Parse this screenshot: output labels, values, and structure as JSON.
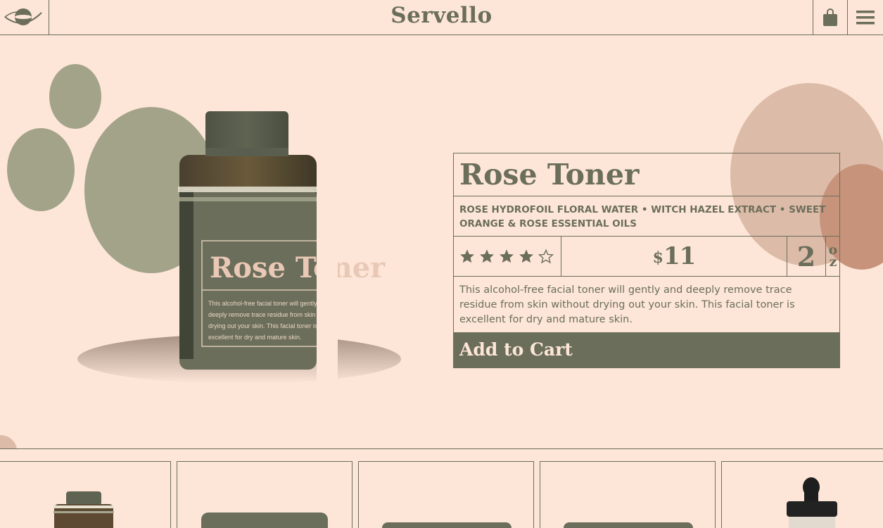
{
  "header": {
    "brand": "Servello",
    "logo_icon": "planet-logo-icon",
    "bag_icon": "shopping-bag-icon",
    "menu_icon": "hamburger-menu-icon"
  },
  "product": {
    "name": "Rose Toner",
    "ingredients": "ROSE HYDROFOIL FLORAL WATER • WITCH HAZEL EXTRACT • SWEET ORANGE & ROSE ESSENTIAL OILS",
    "rating": 4,
    "rating_max": 5,
    "price_currency": "$",
    "price_amount": "11",
    "size_number": "2",
    "size_unit_1": "o",
    "size_unit_2": "z",
    "description": "This alcohol-free facial toner will gently and deeply remove trace residue from skin without drying out your skin. This facial toner is excellent for dry and mature skin.",
    "add_to_cart": "Add to Cart",
    "bottle_label_title": "Rose Toner",
    "bottle_label_lines": [
      "This alcohol-free facial toner will gently and",
      "deeply remove trace residue from skin without",
      "drying out your skin. This facial toner is",
      "excellent for dry and mature skin."
    ]
  },
  "colors": {
    "background": "#fde6d7",
    "accent": "#6b6e5b",
    "sage": "#a3a38a",
    "blush": "#dcbba8",
    "terracotta": "#c7937a"
  }
}
